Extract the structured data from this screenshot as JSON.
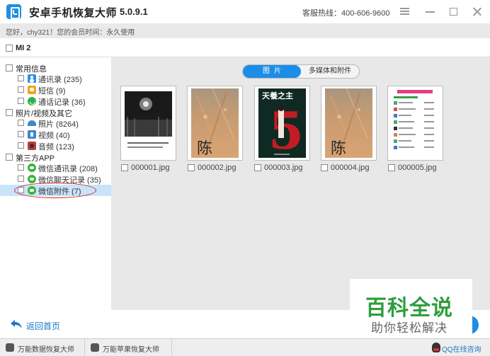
{
  "app": {
    "title": "安卓手机恢复大师",
    "version": "5.0.9.1",
    "hotline": "客服热线：400-606-9600"
  },
  "member": {
    "text": "您好，chy321！您的会员时间：永久使用"
  },
  "device": {
    "label": "MI 2"
  },
  "sidebar": {
    "groups": [
      {
        "label": "常用信息",
        "items": [
          {
            "label": "通讯录 (235)",
            "icon": "contacts-icon"
          },
          {
            "label": "短信 (9)",
            "icon": "sms-icon"
          },
          {
            "label": "通话记录 (36)",
            "icon": "call-log-icon"
          }
        ]
      },
      {
        "label": "照片/视频及其它",
        "items": [
          {
            "label": "照片 (8264)",
            "icon": "photo-icon"
          },
          {
            "label": "视频 (40)",
            "icon": "video-icon"
          },
          {
            "label": "音频 (123)",
            "icon": "audio-icon"
          }
        ]
      },
      {
        "label": "第三方APP",
        "items": [
          {
            "label": "微信通讯录 (208)",
            "icon": "wechat-icon"
          },
          {
            "label": "微信聊天记录 (35)",
            "icon": "wechat-icon"
          },
          {
            "label": "微信附件 (7)",
            "icon": "wechat-icon",
            "selected": true
          }
        ]
      }
    ]
  },
  "main": {
    "tabs": [
      {
        "label": "图片",
        "active": true
      },
      {
        "label": "多媒体和附件",
        "active": false
      }
    ],
    "poster_text": {
      "title": "天養之主",
      "big_char": "陈",
      "numeral": "5"
    },
    "files": [
      {
        "name": "000001.jpg"
      },
      {
        "name": "000002.jpg"
      },
      {
        "name": "000003.jpg"
      },
      {
        "name": "000004.jpg"
      },
      {
        "name": "000005.jpg"
      }
    ]
  },
  "footer": {
    "back_label": "返回首页"
  },
  "watermark": {
    "main": "百科全说",
    "sub": "助你轻松解决"
  },
  "taskbar": {
    "item1": "万能数据恢复大师",
    "item2": "万能苹果恢复大师",
    "qq": "QQ在线咨询"
  },
  "colors": {
    "accent": "#1c8de6",
    "selection": "#c9e4fa",
    "annotation": "#d52020",
    "watermark": "#2e9e3e"
  }
}
